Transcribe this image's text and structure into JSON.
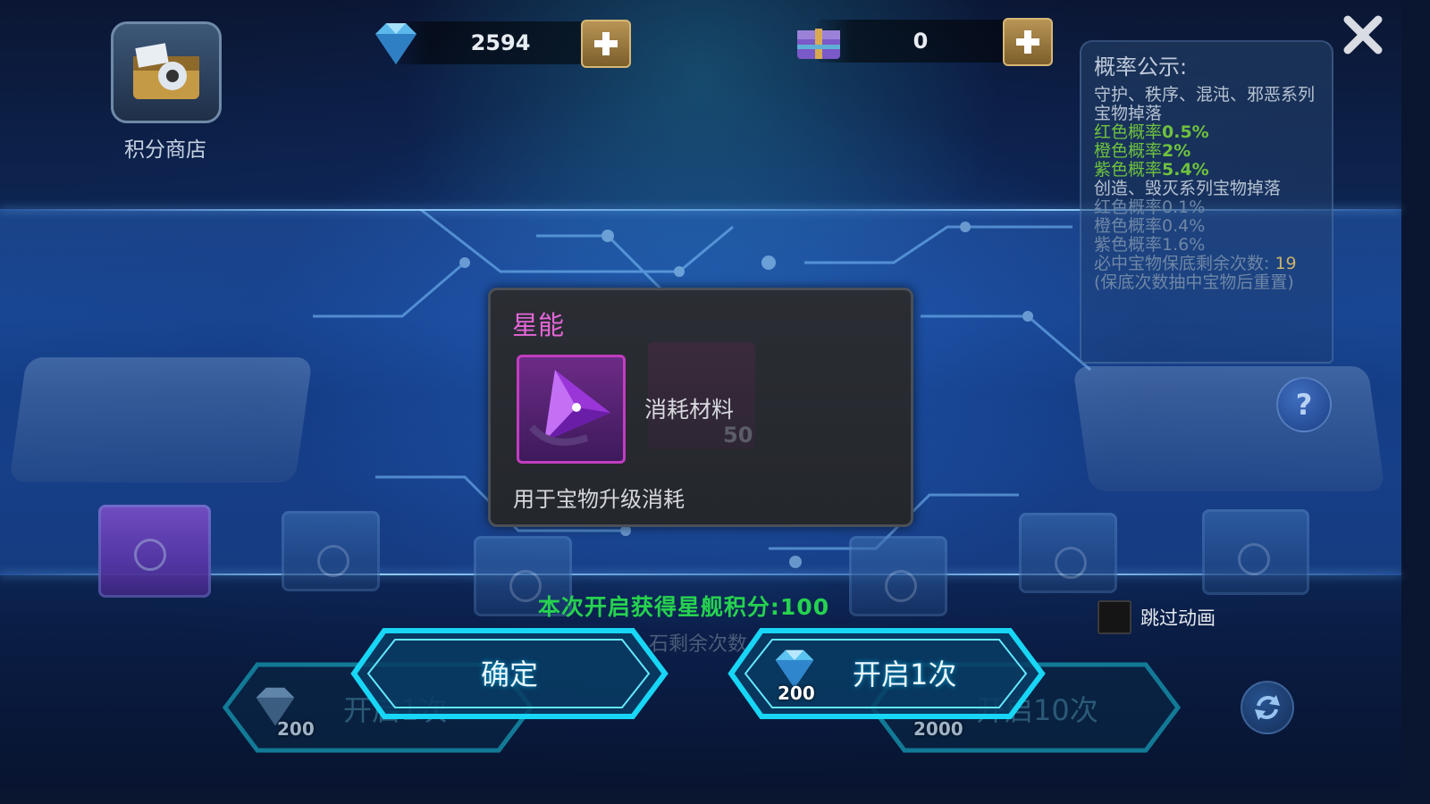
{
  "shop": {
    "label": "积分商店",
    "icon": "shop-chest-icon"
  },
  "currencies": [
    {
      "icon": "diamond-icon",
      "value": "2594"
    },
    {
      "icon": "treasure-chest-icon",
      "value": "0"
    }
  ],
  "probability": {
    "title": "概率公示:",
    "group1": "守护、秩序、混沌、邪恶系列宝物掉落",
    "group1_rates": [
      {
        "label": "红色概率",
        "value": "0.5%"
      },
      {
        "label": "橙色概率",
        "value": "2%"
      },
      {
        "label": "紫色概率",
        "value": "5.4%"
      }
    ],
    "group2": "创造、毁灭系列宝物掉落",
    "group2_rates": [
      {
        "label": "红色概率",
        "value": "0.1%"
      },
      {
        "label": "橙色概率",
        "value": "0.4%"
      },
      {
        "label": "紫色概率",
        "value": "1.6%"
      }
    ],
    "guarantee_label": "必中宝物保底剩余次数:",
    "guarantee_value": "19",
    "guarantee_note": "(保底次数抽中宝物后重置)"
  },
  "dialog": {
    "title": "星能",
    "item_icon": "star-energy-crystal-icon",
    "item_type": "消耗材料",
    "ghost_count": "50",
    "description": "用于宝物升级消耗"
  },
  "result": {
    "points_label": "本次开启获得星舰积分:",
    "points_value": "100"
  },
  "remaining_ghost": "石剩余次数",
  "skip_animation": {
    "label": "跳过动画",
    "checked": false
  },
  "buttons": {
    "confirm": "确定",
    "open_once": "开启1次",
    "open_once_cost": "200",
    "bg_open_once": "开启1次",
    "bg_open_once_cost": "200",
    "bg_open_ten": "开启10次",
    "bg_open_ten_cost": "2000"
  },
  "colors": {
    "dialog_title": "#e466d9",
    "points_text": "#26d24f",
    "rate_green": "#6fc23d",
    "button_glow": "#18d6f5"
  }
}
